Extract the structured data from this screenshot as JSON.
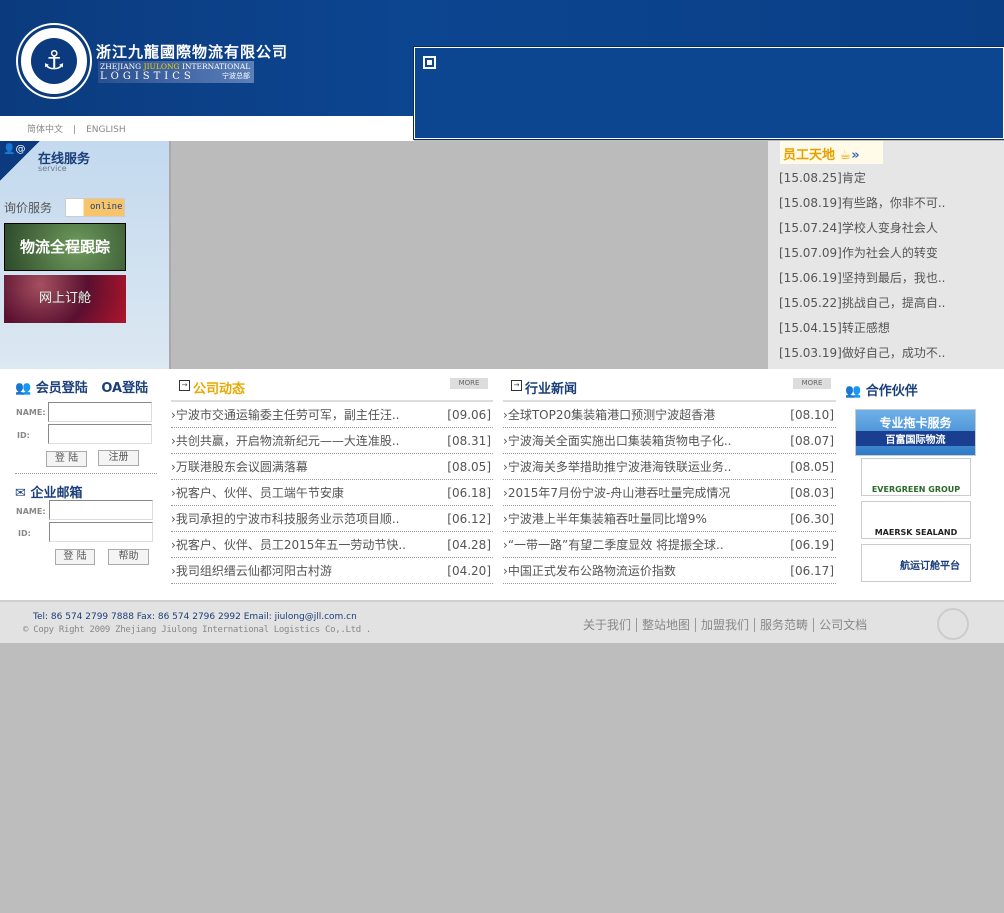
{
  "header": {
    "company_cn": "浙江九龍國際物流有限公司",
    "company_en_1": "ZHEJIANG",
    "company_en_brand": "JIULONG",
    "company_en_2": "INTERNATIONAL",
    "company_en_3": "LOGISTICS",
    "branch": "宁波总部",
    "logo_text": "9LONG LOGISTICS"
  },
  "lang": {
    "cn": "简体中文",
    "en": "ENGLISH"
  },
  "service": {
    "title": "在线服务",
    "subtitle": "service",
    "inquiry": "询价服务",
    "online": "online",
    "tracking": "物流全程跟踪",
    "booking": "网上订舱"
  },
  "staff": {
    "title": "员工天地",
    "items": [
      {
        "date": "[15.08.25]",
        "text": "肯定"
      },
      {
        "date": "[15.08.19]",
        "text": "有些路，你非不可.."
      },
      {
        "date": "[15.07.24]",
        "text": "学校人变身社会人"
      },
      {
        "date": "[15.07.09]",
        "text": "作为社会人的转变"
      },
      {
        "date": "[15.06.19]",
        "text": "坚持到最后，我也.."
      },
      {
        "date": "[15.05.22]",
        "text": "挑战自己，提高自.."
      },
      {
        "date": "[15.04.15]",
        "text": "转正感想"
      },
      {
        "date": "[15.03.19]",
        "text": "做好自己，成功不.."
      }
    ]
  },
  "login": {
    "member": "会员登陆",
    "oa": "OA登陆",
    "name_label": "NAME:",
    "id_label": "ID:",
    "login": "登 陆",
    "register": "注册"
  },
  "mail": {
    "title": "企业邮箱",
    "name_label": "NAME:",
    "id_label": "ID:",
    "login": "登 陆",
    "help": "帮助"
  },
  "company_news": {
    "title": "公司动态",
    "more": "MORE",
    "items": [
      {
        "text": "宁波市交通运输委主任劳可军，副主任汪..",
        "date": "[09.06]"
      },
      {
        "text": "共创共赢，开启物流新纪元——大连准股..",
        "date": "[08.31]"
      },
      {
        "text": "万联港股东会议圆满落幕",
        "date": "[08.05]"
      },
      {
        "text": "祝客户、伙伴、员工端午节安康",
        "date": "[06.18]"
      },
      {
        "text": "我司承担的宁波市科技服务业示范项目顺..",
        "date": "[06.12]"
      },
      {
        "text": "祝客户、伙伴、员工2015年五一劳动节快..",
        "date": "[04.28]"
      },
      {
        "text": "我司组织缙云仙都河阳古村游",
        "date": "[04.20]"
      }
    ]
  },
  "industry_news": {
    "title": "行业新闻",
    "more": "MORE",
    "items": [
      {
        "text": "全球TOP20集装箱港口预测宁波超香港",
        "date": "[08.10]"
      },
      {
        "text": "宁波海关全面实施出口集装箱货物电子化..",
        "date": "[08.07]"
      },
      {
        "text": "宁波海关多举措助推宁波港海铁联运业务..",
        "date": "[08.05]"
      },
      {
        "text": "2015年7月份宁波-舟山港吞吐量完成情况",
        "date": "[08.03]"
      },
      {
        "text": "宁波港上半年集装箱吞吐量同比增9%",
        "date": "[06.30]"
      },
      {
        "text": "“一带一路”有望二季度显效 将提振全球..",
        "date": "[06.19]"
      },
      {
        "text": "中国正式发布公路物流运价指数",
        "date": "[06.17]"
      }
    ]
  },
  "partners": {
    "title": "合作伙伴",
    "items": [
      {
        "text": "专业拖卡服务",
        "sub": "百富国际物流"
      },
      {
        "text": "EVERGREEN GROUP"
      },
      {
        "text": "MAERSK SEALAND"
      },
      {
        "text": "航运订舱平台"
      }
    ]
  },
  "footer": {
    "contact": "Tel: 86 574 2799 7888  Fax: 86 574 2796 2992 Email: jiulong@jll.com.cn",
    "copyright": "© Copy Right 2009 Zhejiang Jiulong International Logistics Co,.Ltd .",
    "links": [
      "关于我们",
      "整站地图",
      "加盟我们",
      "服务范畴",
      "公司文档"
    ]
  }
}
